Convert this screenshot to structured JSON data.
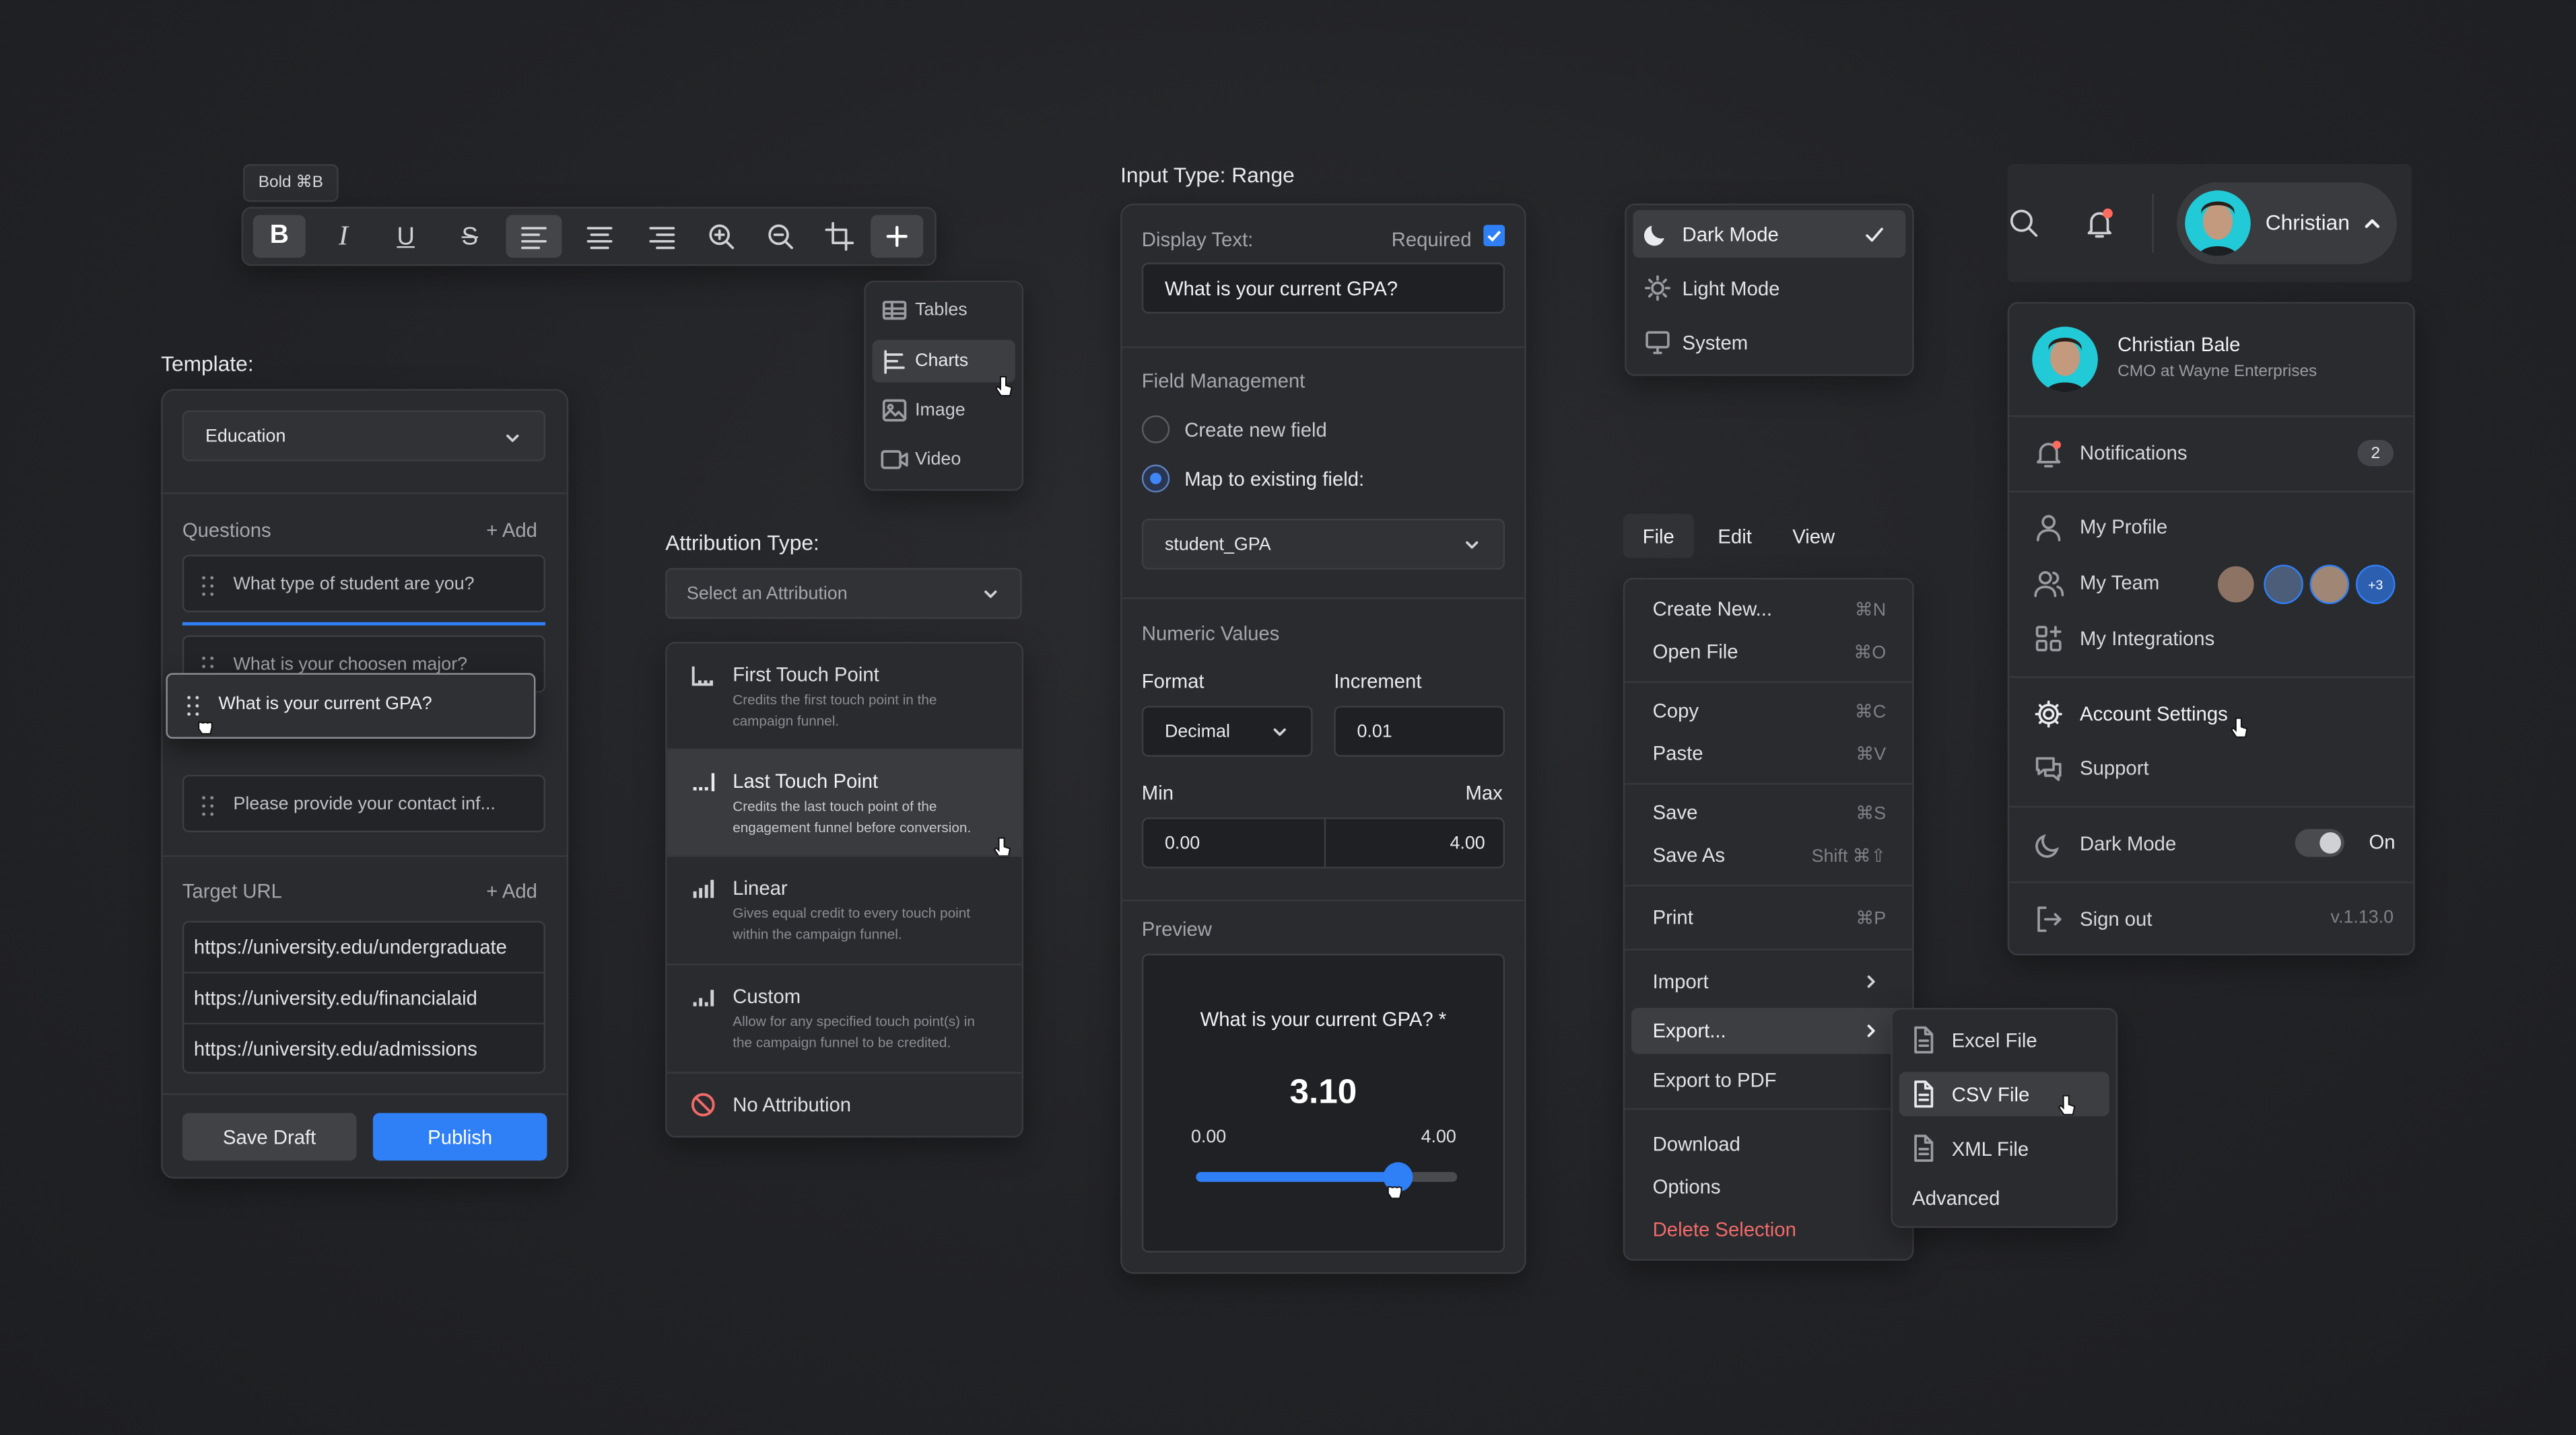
{
  "toolbar": {
    "tooltip": "Bold ⌘B",
    "insert_menu": [
      "Tables",
      "Charts",
      "Image",
      "Video"
    ]
  },
  "template": {
    "label": "Template:",
    "select_value": "Education",
    "questions_label": "Questions",
    "add_label": "+ Add",
    "questions": [
      "What type of student are you?",
      "What is your choosen major?",
      "What is your current GPA?",
      "Please provide your contact inf..."
    ],
    "target_label": "Target URL",
    "urls": [
      "https://university.edu/undergraduate",
      "https://university.edu/financialaid",
      "https://university.edu/admissions"
    ],
    "save_draft": "Save Draft",
    "publish": "Publish"
  },
  "attribution": {
    "label": "Attribution Type:",
    "placeholder": "Select an Attribution",
    "options": [
      {
        "title": "First Touch Point",
        "desc1": "Credits the first touch point in the",
        "desc2": "campaign funnel."
      },
      {
        "title": "Last Touch Point",
        "desc1": "Credits the last touch point of the",
        "desc2": "engagement funnel before conversion."
      },
      {
        "title": "Linear",
        "desc1": "Gives equal credit to every touch point",
        "desc2": "within the campaign funnel."
      },
      {
        "title": "Custom",
        "desc1": "Allow for any specified touch point(s) in",
        "desc2": "the campaign funnel to be credited."
      }
    ],
    "none": "No Attribution"
  },
  "range": {
    "title": "Input Type: Range",
    "display_label": "Display Text:",
    "required_label": "Required",
    "display_value": "What is your current GPA?",
    "field_mgmt": "Field Management",
    "create_new": "Create new field",
    "map_existing": "Map to existing field:",
    "mapped_field": "student_GPA",
    "numeric": "Numeric Values",
    "format_label": "Format",
    "format_value": "Decimal",
    "increment_label": "Increment",
    "increment_value": "0.01",
    "min_label": "Min",
    "max_label": "Max",
    "min_value": "0.00",
    "max_value": "4.00",
    "preview_label": "Preview",
    "preview_question": "What is your current GPA? *",
    "preview_value": "3.10",
    "preview_min": "0.00",
    "preview_max": "4.00",
    "slider_fraction": 0.775
  },
  "theme_menu": {
    "items": [
      "Dark Mode",
      "Light Mode",
      "System"
    ]
  },
  "file_menu": {
    "tabs": [
      "File",
      "Edit",
      "View"
    ],
    "items": [
      {
        "label": "Create New...",
        "kbd": "⌘N"
      },
      {
        "label": "Open File",
        "kbd": "⌘O"
      },
      {
        "label": "Copy",
        "kbd": "⌘C"
      },
      {
        "label": "Paste",
        "kbd": "⌘V"
      },
      {
        "label": "Save",
        "kbd": "⌘S"
      },
      {
        "label": "Save As",
        "kbd": "Shift ⌘⇧"
      },
      {
        "label": "Print",
        "kbd": "⌘P"
      },
      {
        "label": "Import"
      },
      {
        "label": "Export..."
      },
      {
        "label": "Export to PDF"
      },
      {
        "label": "Download"
      },
      {
        "label": "Options"
      },
      {
        "label": "Delete Selection"
      }
    ],
    "export_sub": [
      "Excel File",
      "CSV File",
      "XML File",
      "Advanced"
    ]
  },
  "account": {
    "name_short": "Christian",
    "name": "Christian Bale",
    "role": "CMO at Wayne Enterprises",
    "notifications": "Notifications",
    "notif_count": "2",
    "my_profile": "My Profile",
    "my_team": "My Team",
    "team_more": "+3",
    "integrations": "My Integrations",
    "settings": "Account Settings",
    "support": "Support",
    "dark_mode": "Dark Mode",
    "dark_state": "On",
    "sign_out": "Sign out",
    "version": "v.1.13.0"
  },
  "colors": {
    "accent": "#2f7ff6",
    "danger": "#f06a6a",
    "notif": "#ff6b5e",
    "avatar_bg": "#22c9d6"
  }
}
